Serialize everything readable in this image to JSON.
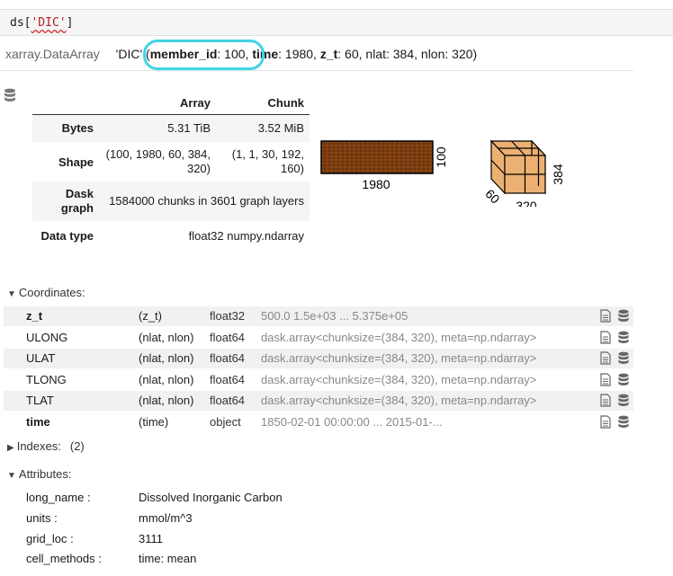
{
  "cell": {
    "code_prefix": "ds[",
    "code_string": "'DIC'",
    "code_suffix": "]"
  },
  "header": {
    "type": "xarray.DataArray",
    "name": "'DIC'",
    "open": "(",
    "dims": [
      {
        "name": "member_id",
        "size": ": 100, "
      },
      {
        "name": "time",
        "size": ": 1980, "
      },
      {
        "name": "z_t",
        "size": ": 60, "
      }
    ],
    "rest": "nlat: 384, nlon: 320)"
  },
  "dask": {
    "col_array": "Array",
    "col_chunk": "Chunk",
    "rows": [
      {
        "label": "Bytes",
        "array": "5.31 TiB",
        "chunk": "3.52 MiB"
      },
      {
        "label": "Shape",
        "array": "(100, 1980, 60, 384, 320)",
        "chunk": "(1, 1, 30, 192, 160)"
      },
      {
        "label": "Dask graph",
        "array": "1584000 chunks in 3601 graph layers",
        "chunk": ""
      },
      {
        "label": "Data type",
        "array": "float32 numpy.ndarray",
        "chunk": ""
      }
    ],
    "labels": {
      "bar_length": "1980",
      "bar_side": "100",
      "cube_height": "384",
      "cube_depth": "60",
      "cube_width": "320"
    },
    "colors": {
      "bar": "#8b4513",
      "cube": "#ecb172"
    }
  },
  "coordinates": {
    "title": "Coordinates:",
    "rows": [
      {
        "name": "z_t",
        "dims": "(z_t)",
        "dtype": "float32",
        "preview": "500.0 1.5e+03 ... 5.375e+05"
      },
      {
        "name": "ULONG",
        "dims": "(nlat, nlon)",
        "dtype": "float64",
        "preview": "dask.array<chunksize=(384, 320), meta=np.ndarray>"
      },
      {
        "name": "ULAT",
        "dims": "(nlat, nlon)",
        "dtype": "float64",
        "preview": "dask.array<chunksize=(384, 320), meta=np.ndarray>"
      },
      {
        "name": "TLONG",
        "dims": "(nlat, nlon)",
        "dtype": "float64",
        "preview": "dask.array<chunksize=(384, 320), meta=np.ndarray>"
      },
      {
        "name": "TLAT",
        "dims": "(nlat, nlon)",
        "dtype": "float64",
        "preview": "dask.array<chunksize=(384, 320), meta=np.ndarray>"
      },
      {
        "name": "time",
        "dims": "(time)",
        "dtype": "object",
        "preview": "1850-02-01 00:00:00 ... 2015-01-..."
      }
    ]
  },
  "indexes": {
    "title": "Indexes:",
    "count": "(2)"
  },
  "attributes": {
    "title": "Attributes:",
    "items": [
      {
        "key": "long_name :",
        "value": "Dissolved Inorganic Carbon"
      },
      {
        "key": "units :",
        "value": "mmol/m^3"
      },
      {
        "key": "grid_loc :",
        "value": "3111"
      },
      {
        "key": "cell_methods :",
        "value": "time: mean"
      }
    ]
  }
}
